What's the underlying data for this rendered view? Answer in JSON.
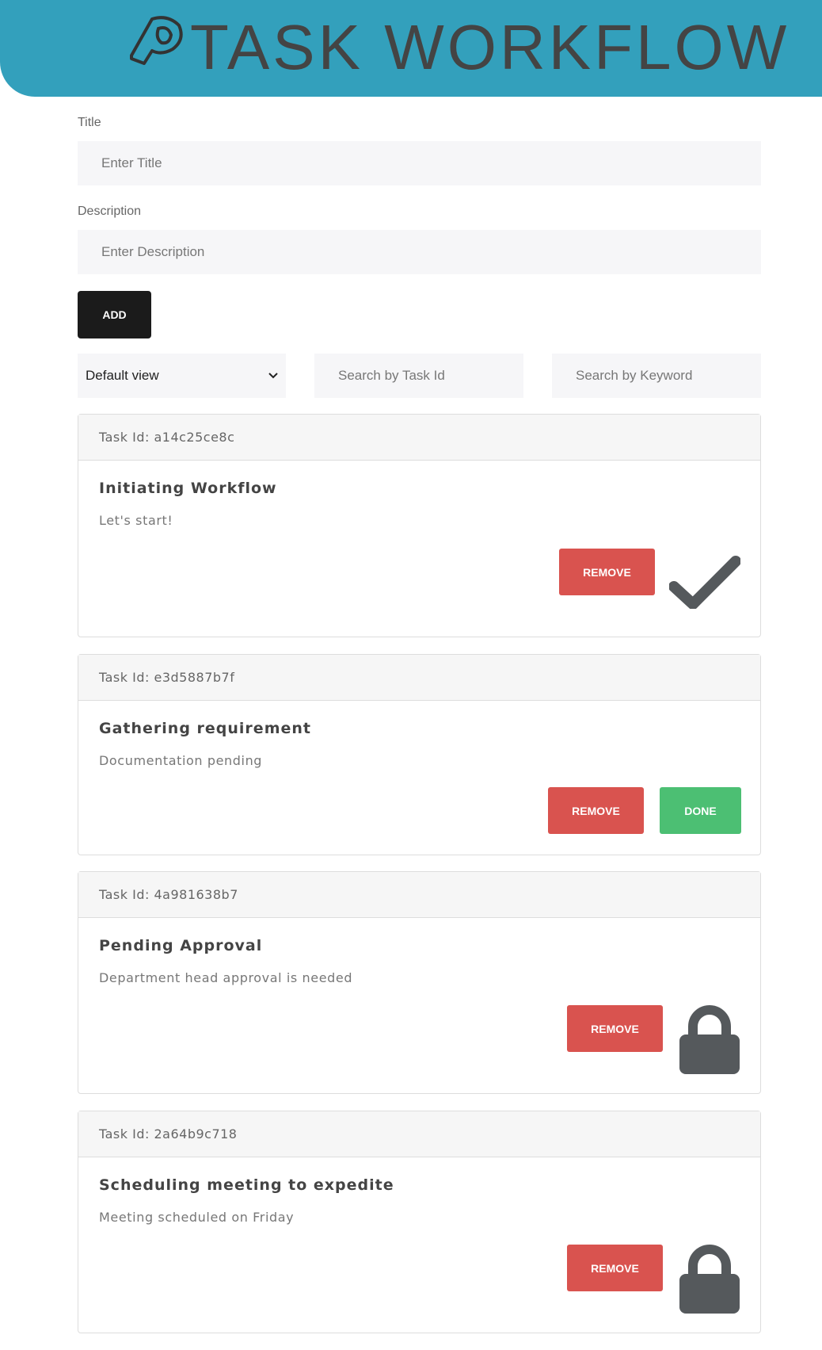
{
  "header": {
    "title": "TASK WORKFLOW",
    "background": "#33a0bc"
  },
  "form": {
    "title_label": "Title",
    "title_placeholder": "Enter Title",
    "description_label": "Description",
    "description_placeholder": "Enter Description",
    "add_label": "ADD"
  },
  "filters": {
    "view_selected": "Default view",
    "task_id_placeholder": "Search by Task Id",
    "keyword_placeholder": "Search by Keyword"
  },
  "tasks": [
    {
      "id_label": "Task Id: a14c25ce8c",
      "title": "Initiating Workflow",
      "description": "Let's start!",
      "remove_label": "REMOVE",
      "status_icon": "check-icon"
    },
    {
      "id_label": "Task Id: e3d5887b7f",
      "title": "Gathering requirement",
      "description": "Documentation pending",
      "remove_label": "REMOVE",
      "done_label": "DONE"
    },
    {
      "id_label": "Task Id: 4a981638b7",
      "title": "Pending Approval",
      "description": "Department head approval is needed",
      "remove_label": "REMOVE",
      "status_icon": "lock-icon"
    },
    {
      "id_label": "Task Id: 2a64b9c718",
      "title": "Scheduling meeting to expedite",
      "description": "Meeting scheduled on Friday",
      "remove_label": "REMOVE",
      "status_icon": "lock-icon"
    }
  ],
  "colors": {
    "remove": "#d9534f",
    "done": "#4cbf73",
    "icon": "#55595c"
  }
}
